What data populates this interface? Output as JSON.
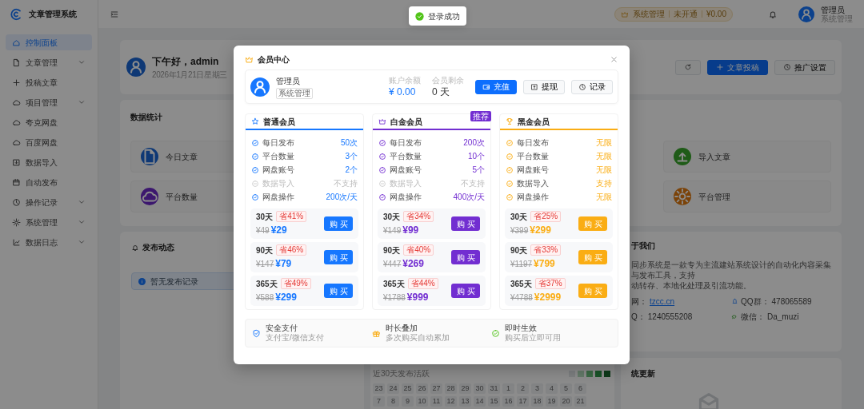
{
  "app": {
    "title": "文章管理系统"
  },
  "sidebar": {
    "items": [
      {
        "label": "控制面板",
        "selected": true,
        "expandable": false
      },
      {
        "label": "文章管理",
        "selected": false,
        "expandable": true
      },
      {
        "label": "投稿文章",
        "selected": false,
        "expandable": false
      },
      {
        "label": "项目管理",
        "selected": false,
        "expandable": true
      },
      {
        "label": "夸克网盘",
        "selected": false,
        "expandable": false
      },
      {
        "label": "百度网盘",
        "selected": false,
        "expandable": false
      },
      {
        "label": "数据导入",
        "selected": false,
        "expandable": false
      },
      {
        "label": "自动发布",
        "selected": false,
        "expandable": false
      },
      {
        "label": "操作记录",
        "selected": false,
        "expandable": true
      },
      {
        "label": "系统管理",
        "selected": false,
        "expandable": true
      },
      {
        "label": "数据日志",
        "selected": false,
        "expandable": true
      }
    ]
  },
  "header": {
    "status_pill": [
      "系统管理",
      "未开通",
      "¥0.00"
    ],
    "user": {
      "name": "管理员",
      "role": "系统管理"
    }
  },
  "welcome": {
    "greeting": "下午好，admin",
    "date": "2026年1月21日星期三",
    "buttons": [
      {
        "label": "文章投稿",
        "kind": "primary"
      },
      {
        "label": "推广设置",
        "kind": "outline"
      }
    ]
  },
  "stats": {
    "title": "数据统计",
    "tiles": [
      {
        "label": "今日文章"
      },
      {
        "label": "导入文章"
      },
      {
        "label": "平台数量"
      },
      {
        "label": "平台管理"
      }
    ]
  },
  "activity": {
    "title": "发布动态",
    "empty_text": "暂无发布记录"
  },
  "heatmap": {
    "label": "近30天发布活跃",
    "days": [
      "23",
      "24",
      "25",
      "26",
      "27",
      "28",
      "29",
      "30",
      "31",
      "1",
      "2",
      "3",
      "4",
      "5",
      "6",
      "7",
      "8",
      "9",
      "10",
      "11",
      "12",
      "13",
      "14",
      "15",
      "16",
      "17",
      "18",
      "19",
      "20",
      "21"
    ]
  },
  "about": {
    "title": "于我们",
    "lines": [
      "同步系统是一款专为主流建站系统设计的自动化内容采集与发布工具，支持",
      "动转存、本地化处理及引流功能。"
    ],
    "contacts": [
      {
        "label": "网：",
        "value": "tzcc.cn",
        "link": true
      },
      {
        "label": "QQ群：",
        "value": "478065589",
        "link": false
      },
      {
        "label": "Q：",
        "value": "1240555208",
        "link": false
      },
      {
        "label": "微信：",
        "value": "Da_muzi",
        "link": false
      }
    ]
  },
  "updates": {
    "title": "统更新"
  },
  "membership_modal": {
    "title": "会员中心",
    "user": {
      "name": "管理员",
      "role": "系统管理"
    },
    "balance": {
      "label": "账户余额",
      "value": "¥ 0.00"
    },
    "remaining": {
      "label": "会员剩余",
      "value": "0 天"
    },
    "actions": [
      {
        "label": "充值",
        "kind": "primary"
      },
      {
        "label": "提现",
        "kind": "outline"
      },
      {
        "label": "记录",
        "kind": "outline"
      }
    ],
    "plans": [
      {
        "name": "普通会员",
        "color": "#1677ff",
        "features": [
          {
            "label": "每日发布",
            "value": "50次",
            "supported": true
          },
          {
            "label": "平台数量",
            "value": "3个",
            "supported": true
          },
          {
            "label": "网盘账号",
            "value": "2个",
            "supported": true
          },
          {
            "label": "数据导入",
            "value": "不支持",
            "supported": false
          },
          {
            "label": "网盘操作",
            "value": "200次/天",
            "supported": true
          }
        ],
        "prices": [
          {
            "duration": "30天",
            "discount": "省41%",
            "original": "¥49",
            "price": "¥29",
            "button": "购买"
          },
          {
            "duration": "90天",
            "discount": "省46%",
            "original": "¥147",
            "price": "¥79",
            "button": "购买"
          },
          {
            "duration": "365天",
            "discount": "省49%",
            "original": "¥588",
            "price": "¥299",
            "button": "购买"
          }
        ]
      },
      {
        "name": "白金会员",
        "color": "#722ed1",
        "badge": "推荐",
        "features": [
          {
            "label": "每日发布",
            "value": "200次",
            "supported": true
          },
          {
            "label": "平台数量",
            "value": "10个",
            "supported": true
          },
          {
            "label": "网盘账号",
            "value": "5个",
            "supported": true
          },
          {
            "label": "数据导入",
            "value": "不支持",
            "supported": false
          },
          {
            "label": "网盘操作",
            "value": "400次/天",
            "supported": true
          }
        ],
        "prices": [
          {
            "duration": "30天",
            "discount": "省34%",
            "original": "¥149",
            "price": "¥99",
            "button": "购买"
          },
          {
            "duration": "90天",
            "discount": "省40%",
            "original": "¥447",
            "price": "¥269",
            "button": "购买"
          },
          {
            "duration": "365天",
            "discount": "省44%",
            "original": "¥1788",
            "price": "¥999",
            "button": "购买"
          }
        ]
      },
      {
        "name": "黑金会员",
        "color": "#faad14",
        "features": [
          {
            "label": "每日发布",
            "value": "无限",
            "supported": true
          },
          {
            "label": "平台数量",
            "value": "无限",
            "supported": true
          },
          {
            "label": "网盘账号",
            "value": "无限",
            "supported": true
          },
          {
            "label": "数据导入",
            "value": "支持",
            "supported": true
          },
          {
            "label": "网盘操作",
            "value": "无限",
            "supported": true
          }
        ],
        "prices": [
          {
            "duration": "30天",
            "discount": "省25%",
            "original": "¥399",
            "price": "¥299",
            "button": "购买"
          },
          {
            "duration": "90天",
            "discount": "省33%",
            "original": "¥1197",
            "price": "¥799",
            "button": "购买"
          },
          {
            "duration": "365天",
            "discount": "省37%",
            "original": "¥4788",
            "price": "¥2999",
            "button": "购买"
          }
        ]
      }
    ],
    "perks": [
      {
        "title": "安全支付",
        "subtitle": "支付宝/微信支付"
      },
      {
        "title": "时长叠加",
        "subtitle": "多次购买自动累加"
      },
      {
        "title": "即时生效",
        "subtitle": "购买后立即可用"
      }
    ]
  },
  "toast": {
    "text": "登录成功"
  }
}
